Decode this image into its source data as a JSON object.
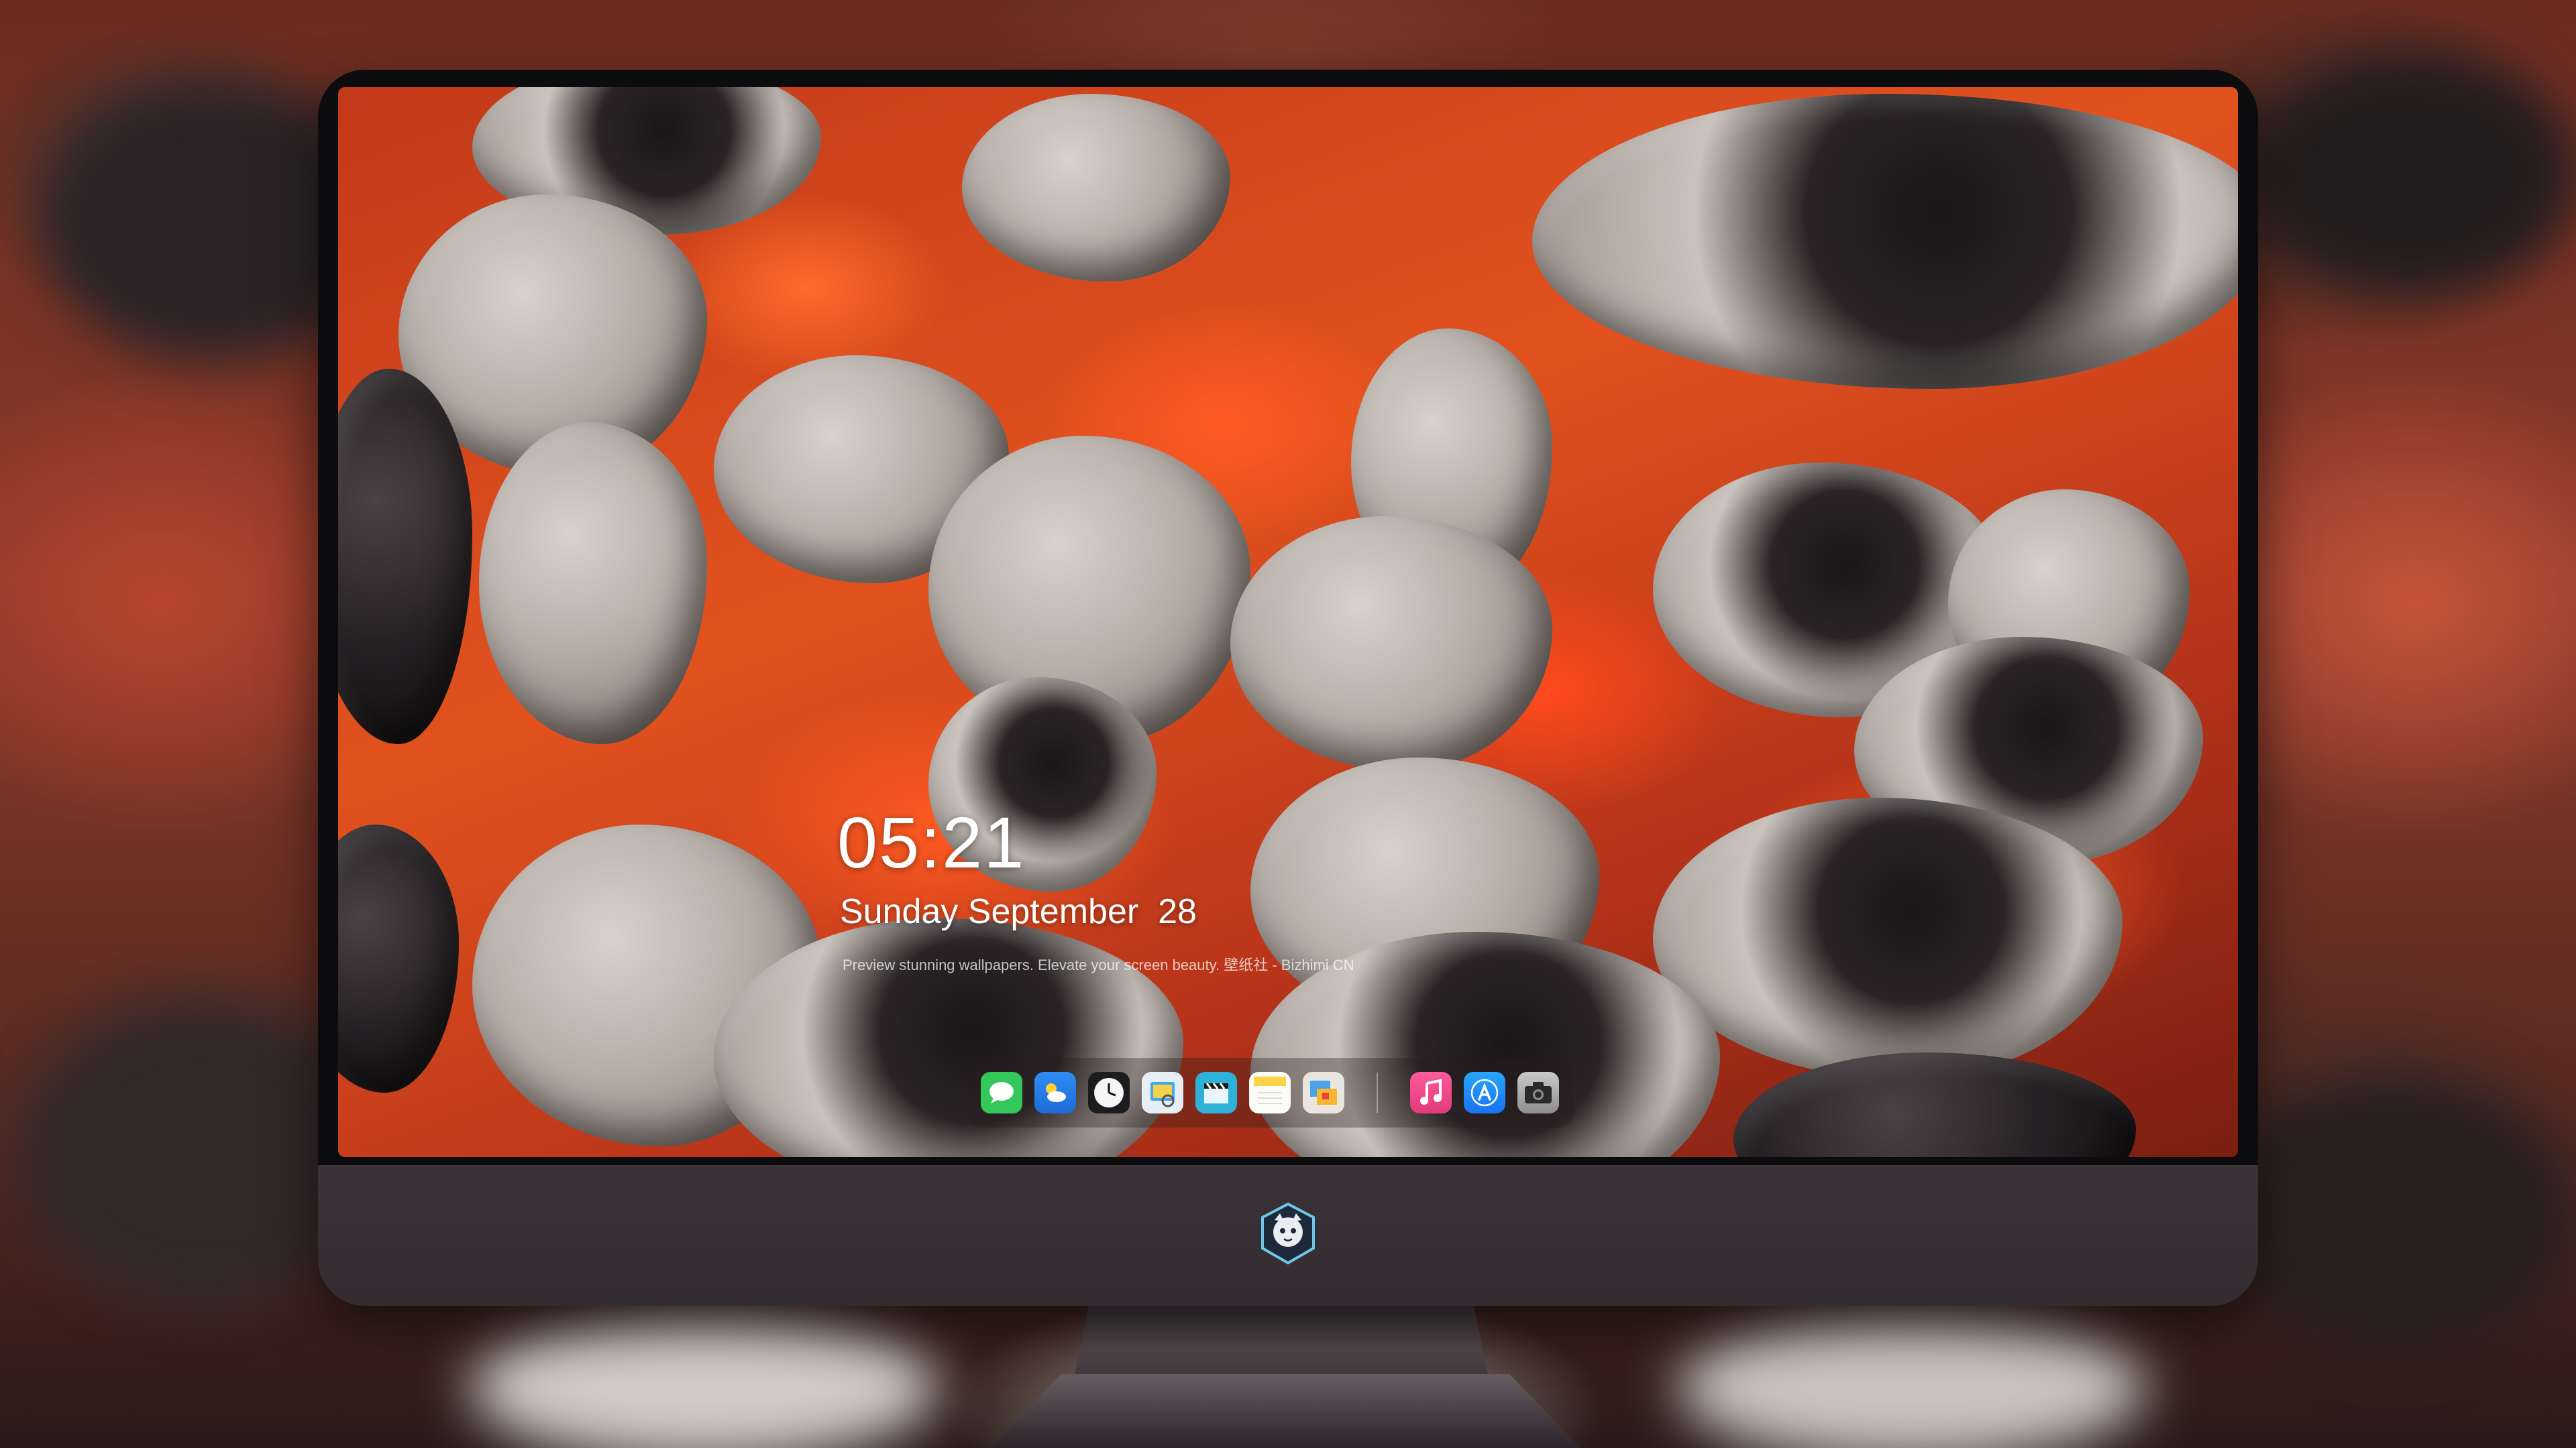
{
  "desktop": {
    "time": "05:21",
    "date": "Sunday September  28",
    "tagline": "Preview stunning wallpapers. Elevate your screen beauty. 壁纸社 - Bizhimi CN"
  },
  "dock": {
    "items": [
      {
        "name": "messages-icon",
        "color": "#34c759"
      },
      {
        "name": "weather-icon",
        "color": "#2f8df5"
      },
      {
        "name": "clock-icon",
        "color": "#f2f2f2"
      },
      {
        "name": "preview-icon",
        "color": "#3ea8f0"
      },
      {
        "name": "clapper-icon",
        "color": "#2fb0d6"
      },
      {
        "name": "notes-icon",
        "color": "#fbd349"
      },
      {
        "name": "photos-icon",
        "color": "#e9e6e0"
      },
      {
        "name": "music-icon",
        "color": "#f54a8c"
      },
      {
        "name": "app-store-icon",
        "color": "#1a8cff"
      },
      {
        "name": "camera-icon",
        "color": "#9a9a9a"
      }
    ]
  },
  "colors": {
    "bezel": "#0c0c0e",
    "chin": "#352e32",
    "ember": "#e2521e"
  }
}
